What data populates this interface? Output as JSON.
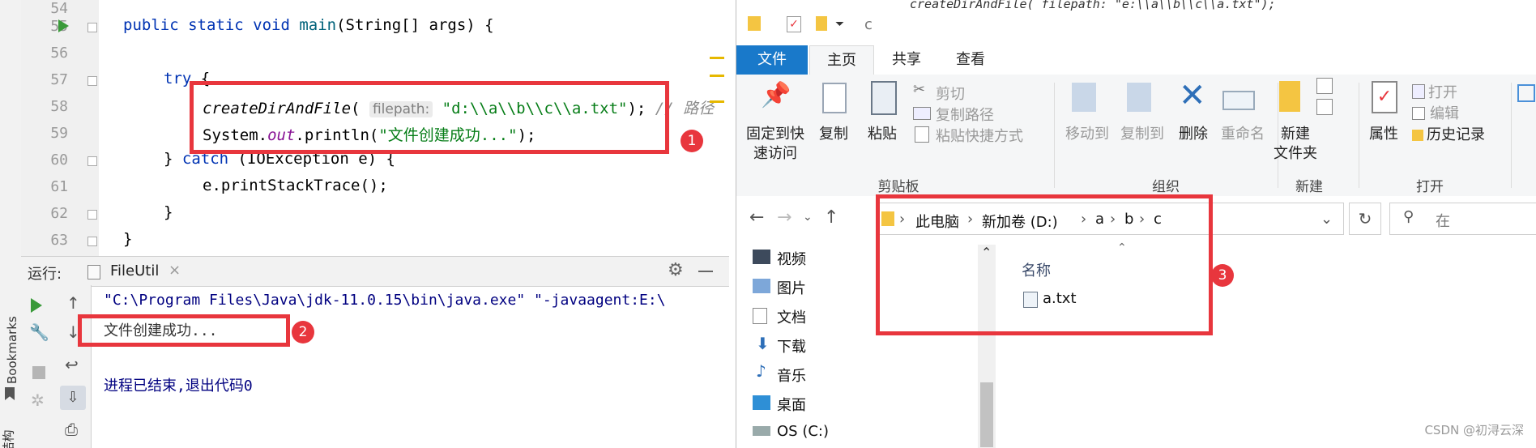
{
  "ide": {
    "line_numbers": [
      "54",
      "55",
      "56",
      "57",
      "58",
      "59",
      "60",
      "61",
      "62",
      "63"
    ],
    "code": {
      "l55_kw": "public static void ",
      "l55_fn": "main",
      "l55_rest": "(String[] args) {",
      "l57_kw": "try",
      "l57_rest": " {",
      "l58_call": "createDirAndFile",
      "l58_open": "(",
      "l58_hint": "filepath:",
      "l58_str": "\"d:\\\\a\\\\b\\\\c\\\\a.txt\"",
      "l58_close": ");",
      "l58_comment": "// 路径",
      "l59_a": "System.",
      "l59_field": "out",
      "l59_b": ".println(",
      "l59_str": "\"文件创建成功...\"",
      "l59_c": ");",
      "l60_a": "} ",
      "l60_kw": "catch",
      "l60_b": " (IOException e) {",
      "l61": "e.printStackTrace();",
      "l62": "}",
      "l63": "}"
    },
    "run": {
      "label": "运行:",
      "tab": "FileUtil",
      "line1": "\"C:\\Program Files\\Java\\jdk-11.0.15\\bin\\java.exe\" \"-javaagent:E:\\",
      "line2": "文件创建成功...",
      "line3": "进程已结束,退出代码0"
    },
    "side_labels": {
      "bookmarks": "Bookmarks",
      "structure": "结构"
    },
    "badges": {
      "one": "1",
      "two": "2"
    }
  },
  "explorer": {
    "title_path": "c",
    "top_fragment": "createDirAndFile( filepath: \"e:\\\\a\\\\b\\\\c\\\\a.txt\");",
    "tabs": [
      "文件",
      "主页",
      "共享",
      "查看"
    ],
    "ribbon": {
      "pin_l1": "固定到快",
      "pin_l2": "速访问",
      "copy": "复制",
      "paste": "粘贴",
      "cut": "剪切",
      "copy_path": "复制路径",
      "paste_shortcut": "粘贴快捷方式",
      "move_to": "移动到",
      "copy_to": "复制到",
      "delete": "删除",
      "rename": "重命名",
      "new_folder_l1": "新建",
      "new_folder_l2": "文件夹",
      "properties": "属性",
      "open": "打开",
      "edit": "编辑",
      "history": "历史记录",
      "group_clipboard": "剪贴板",
      "group_organize": "组织",
      "group_new": "新建",
      "group_open": "打开"
    },
    "breadcrumbs": [
      "此电脑",
      "新加卷 (D:)",
      "a",
      "b",
      "c"
    ],
    "search_placeholder": "在",
    "nav": [
      "视频",
      "图片",
      "文档",
      "下载",
      "音乐",
      "桌面",
      "OS (C:)"
    ],
    "column_name": "名称",
    "files": [
      "a.txt"
    ],
    "badge_three": "3",
    "watermark": "CSDN @初浔云深"
  },
  "colors": {
    "annotation_red": "#e8363d",
    "ribbon_file_tab": "#1979ca"
  }
}
